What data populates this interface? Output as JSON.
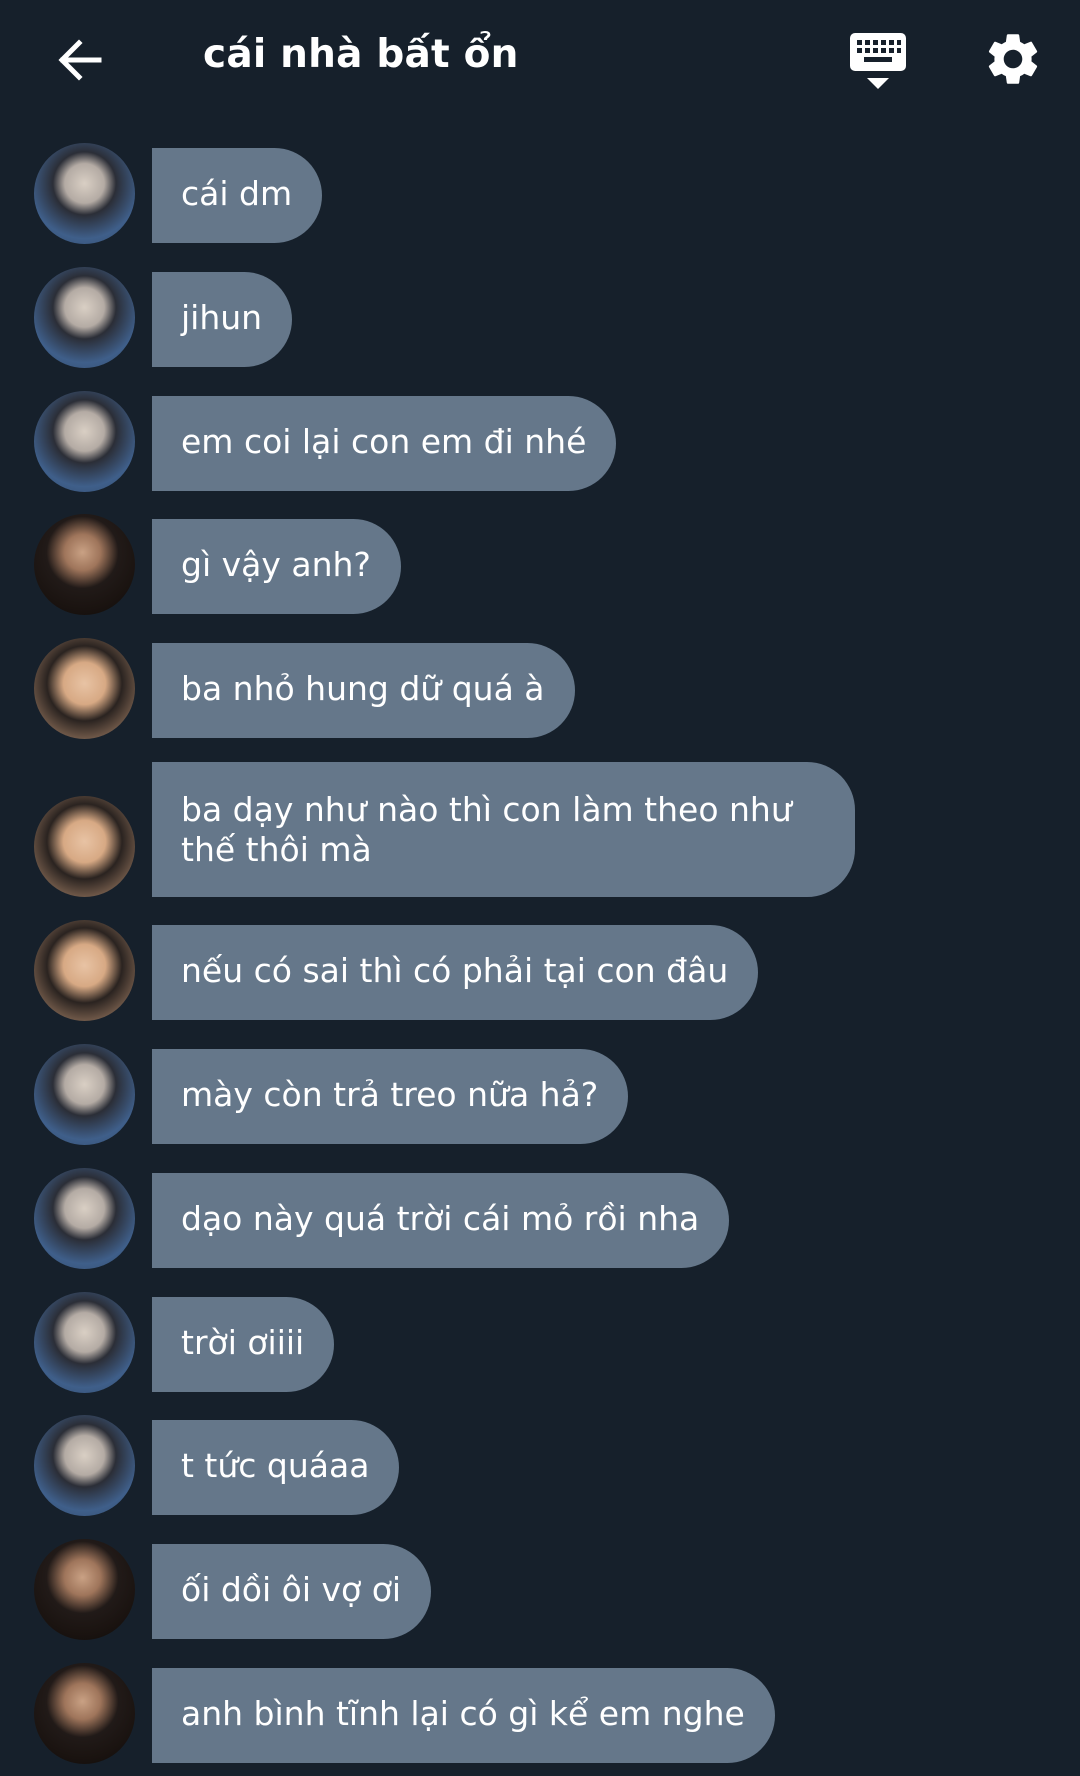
{
  "header": {
    "title": "cái nhà bất ổn",
    "back_icon": "arrow-left-icon",
    "keyboard_icon": "keyboard-hide-icon",
    "settings_icon": "gear-icon"
  },
  "colors": {
    "background": "#16202b",
    "bubble": "#65778a",
    "text": "#ffffff"
  },
  "messages": [
    {
      "sender": "a",
      "text": "cái dm"
    },
    {
      "sender": "a",
      "text": "jihun"
    },
    {
      "sender": "a",
      "text": "em coi lại con em đi nhé"
    },
    {
      "sender": "b",
      "text": "gì vậy anh?"
    },
    {
      "sender": "c",
      "text": "ba nhỏ hung dữ quá à"
    },
    {
      "sender": "c",
      "text": "ba dạy như nào thì con làm theo như thế thôi mà"
    },
    {
      "sender": "c",
      "text": "nếu có sai thì có phải tại con đâu"
    },
    {
      "sender": "a",
      "text": "mày còn trả treo nữa hả?"
    },
    {
      "sender": "a",
      "text": "dạo này quá trời cái mỏ rồi nha"
    },
    {
      "sender": "a",
      "text": "trời ơiiii"
    },
    {
      "sender": "a",
      "text": "t tức quáaa"
    },
    {
      "sender": "b",
      "text": "ối dồi ôi vợ ơi"
    },
    {
      "sender": "b",
      "text": "anh bình tĩnh lại có gì kể em nghe"
    }
  ]
}
